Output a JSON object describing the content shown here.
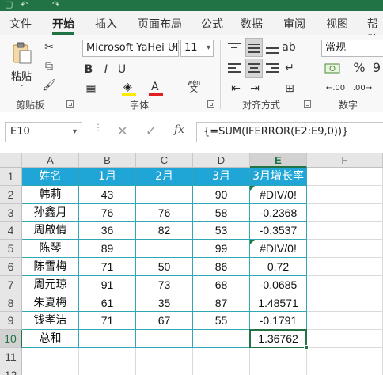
{
  "ribbon_tabs": [
    "文件",
    "开始",
    "插入",
    "页面布局",
    "公式",
    "数据",
    "审阅",
    "视图",
    "帮助"
  ],
  "active_tab": "开始",
  "clipboard": {
    "paste_label": "粘贴",
    "group_label": "剪贴板"
  },
  "font": {
    "name": "Microsoft YaHei UI",
    "size": "11",
    "grow_label": "A",
    "shrink_label": "A",
    "group_label": "字体",
    "bold": "B",
    "italic": "I",
    "underline": "U",
    "phonetic": "wén"
  },
  "alignment": {
    "group_label": "对齐方式"
  },
  "number": {
    "format": "常规",
    "currency": "$",
    "percent": "%",
    "comma": "9",
    "group_label": "数字"
  },
  "formula_bar": {
    "name_box": "E10",
    "cancel": "✕",
    "enter": "✓",
    "fx": "fx",
    "formula": "{=SUM(IFERROR(E2:E9,0))}"
  },
  "columns": [
    "A",
    "B",
    "C",
    "D",
    "E",
    "F"
  ],
  "selected_column": "E",
  "rows": [
    "1",
    "2",
    "3",
    "4",
    "5",
    "6",
    "7",
    "8",
    "9",
    "10",
    "11",
    "12"
  ],
  "selected_row": "10",
  "table": {
    "header": [
      "姓名",
      "1月",
      "2月",
      "3月",
      "3月增长率"
    ],
    "body": [
      [
        "韩莉",
        "43",
        "",
        "90",
        "#DIV/0!"
      ],
      [
        "孙鑫月",
        "76",
        "76",
        "58",
        "-0.2368"
      ],
      [
        "周啟倩",
        "36",
        "82",
        "53",
        "-0.3537"
      ],
      [
        "陈琴",
        "89",
        "",
        "99",
        "#DIV/0!"
      ],
      [
        "陈雪梅",
        "71",
        "50",
        "86",
        "0.72"
      ],
      [
        "周元琼",
        "91",
        "73",
        "68",
        "-0.0685"
      ],
      [
        "朱夏梅",
        "61",
        "35",
        "87",
        "1.48571"
      ],
      [
        "钱孝洁",
        "71",
        "67",
        "55",
        "-0.1791"
      ]
    ],
    "total": [
      "总和",
      "",
      "",
      "",
      "1.36762"
    ]
  },
  "colors": {
    "accent": "#217346",
    "table_header": "#1fa6d6",
    "table_border": "#31a7b5"
  }
}
